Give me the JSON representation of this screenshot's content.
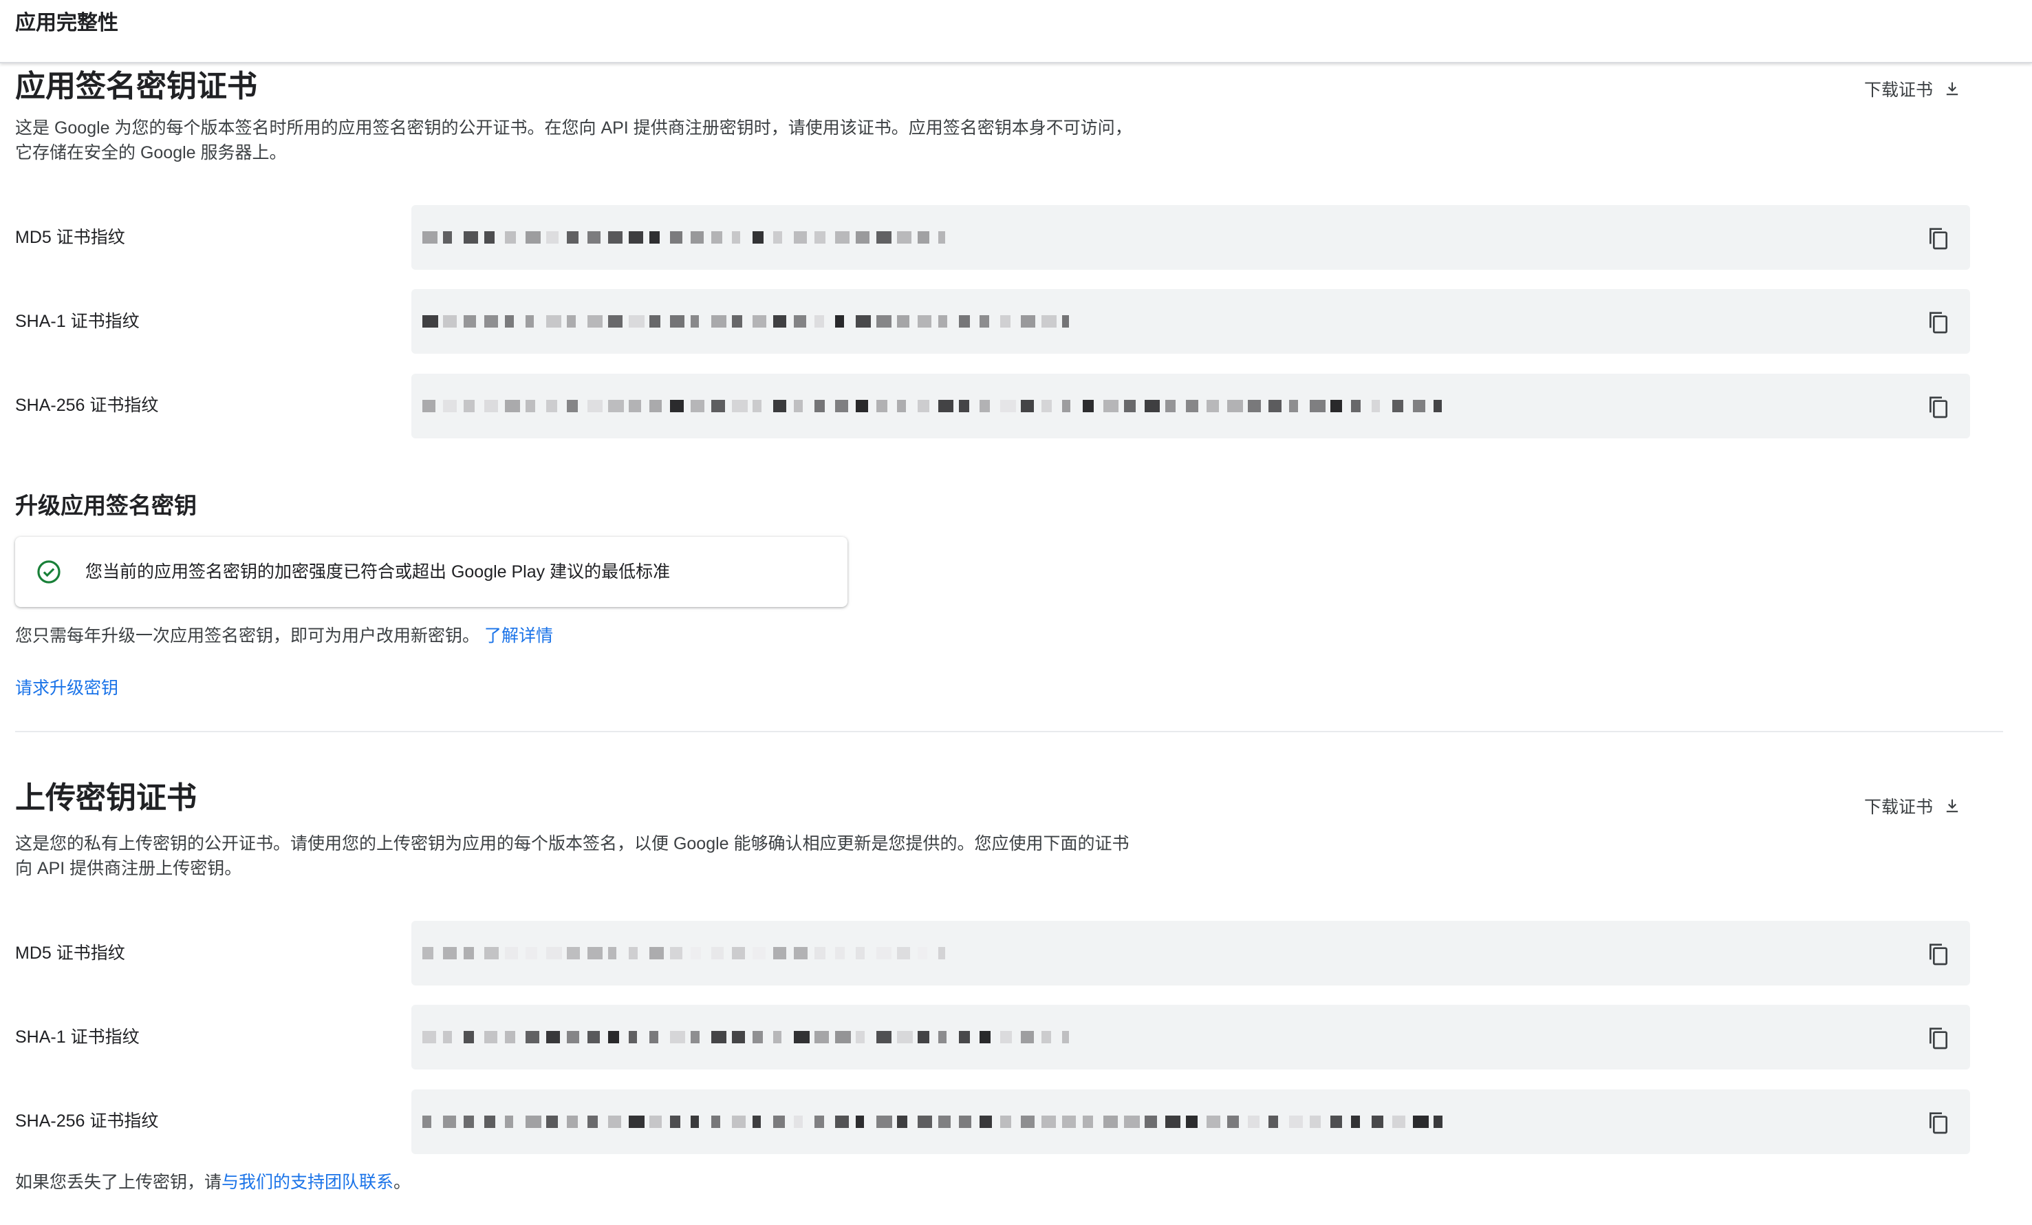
{
  "page": {
    "title": "应用完整性"
  },
  "app_signing": {
    "title": "应用签名密钥证书",
    "description": "这是 Google 为您的每个版本签名时所用的应用签名密钥的公开证书。在您向 API 提供商注册密钥时，请使用该证书。应用签名密钥本身不可访问，它存储在安全的 Google 服务器上。",
    "download_label": "下载证书",
    "fingerprints": [
      {
        "label": "MD5 证书指纹",
        "value": ""
      },
      {
        "label": "SHA-1 证书指纹",
        "value": ""
      },
      {
        "label": "SHA-256 证书指纹",
        "value": ""
      }
    ]
  },
  "upgrade": {
    "title": "升级应用签名密钥",
    "status_message": "您当前的应用签名密钥的加密强度已符合或超出 Google Play 建议的最低标准",
    "info_text": "您只需每年升级一次应用签名密钥，即可为用户改用新密钥。",
    "learn_more": "了解详情",
    "request_link": "请求升级密钥"
  },
  "upload_key": {
    "title": "上传密钥证书",
    "description": "这是您的私有上传密钥的公开证书。请使用您的上传密钥为应用的每个版本签名，以便 Google 能够确认相应更新是您提供的。您应使用下面的证书向 API 提供商注册上传密钥。",
    "download_label": "下载证书",
    "fingerprints": [
      {
        "label": "MD5 证书指纹",
        "value": ""
      },
      {
        "label": "SHA-1 证书指纹",
        "value": ""
      },
      {
        "label": "SHA-256 证书指纹",
        "value": ""
      }
    ],
    "lost_key_prefix": "如果您丢失了上传密钥，请",
    "lost_key_link": "与我们的支持团队联系",
    "lost_key_suffix": "。"
  },
  "colors": {
    "accent": "#1a73e8",
    "success": "#188038",
    "field_bg": "#f1f3f4"
  },
  "icons": {
    "download": "download-icon",
    "copy": "copy-icon",
    "status": "check-circle-icon"
  }
}
